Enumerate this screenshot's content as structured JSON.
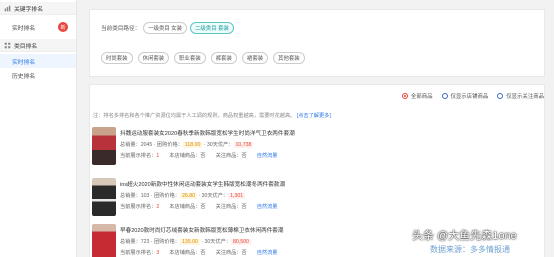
{
  "sidebar": {
    "section1": "关键字排名",
    "items1": [
      {
        "label": "实时排名",
        "badge": "新"
      }
    ],
    "section2": "类目排名",
    "items2": [
      {
        "label": "实时排名"
      },
      {
        "label": "历史排名"
      }
    ]
  },
  "filter": {
    "crumb_label": "当前类目路径：",
    "crumb_tag1": "一级类目 女装",
    "crumb_tag2": "二级类目 套装",
    "tags": [
      "时尚套装",
      "休闲套装",
      "职业套装",
      "裤套装",
      "裙套装",
      "其他套装"
    ]
  },
  "radios": [
    "全部商品",
    "仅显示店铺商品",
    "仅显示关注商品"
  ],
  "note": {
    "text": "注：排名多排名和各个推广资源位均属于人工调的规则，商品权重越高，需要时花越高。",
    "link": "[点击了解更多]"
  },
  "products": [
    {
      "title": "抖魏运动服套装女2020春秋季新款韩版宽松学生时尚洋气卫衣两件套潮",
      "sales_label": "总销量：2045",
      "price_label": "团购价格：",
      "price": "118.00",
      "trend_label": "30天优产：",
      "trend": "10,738",
      "rank_label": "当前展示排名：",
      "rank": "1",
      "store_label": "本店铺商品：",
      "store": "否",
      "follow_label": "关注商品：",
      "follow": "否",
      "flow": "自然流量",
      "color": "#b8323c"
    },
    {
      "title": "ins超火2020新款中性休闲运动套装女学生韩版宽松潮冬两件套款潮",
      "sales_label": "总销量：103",
      "price_label": "团购价格：",
      "price": "26.80",
      "trend_label": "30天优产：",
      "trend": "1,301",
      "rank_label": "当前展示排名：",
      "rank": "2",
      "store_label": "本店铺商品：",
      "store": "否",
      "follow_label": "关注商品：",
      "follow": "否",
      "flow": "自然流量",
      "color": "#2a2a2a"
    },
    {
      "title": "早春2020款时尚灯芯绒套装女新款韩版宽松薄棉卫衣休闲两件套潮",
      "sales_label": "总销量：723",
      "price_label": "团购价格：",
      "price": "135.00",
      "trend_label": "30天优产：",
      "trend": "80,500",
      "rank_label": "当前展示排名：",
      "rank": "3",
      "store_label": "本店铺商品：",
      "store": "否",
      "follow_label": "关注商品：",
      "follow": "否",
      "flow": "自然流量",
      "color": "#c42b33"
    }
  ],
  "watermark": {
    "line1": "头条 @大鱼先森1one",
    "line2": "数据来源：多多情报通"
  }
}
